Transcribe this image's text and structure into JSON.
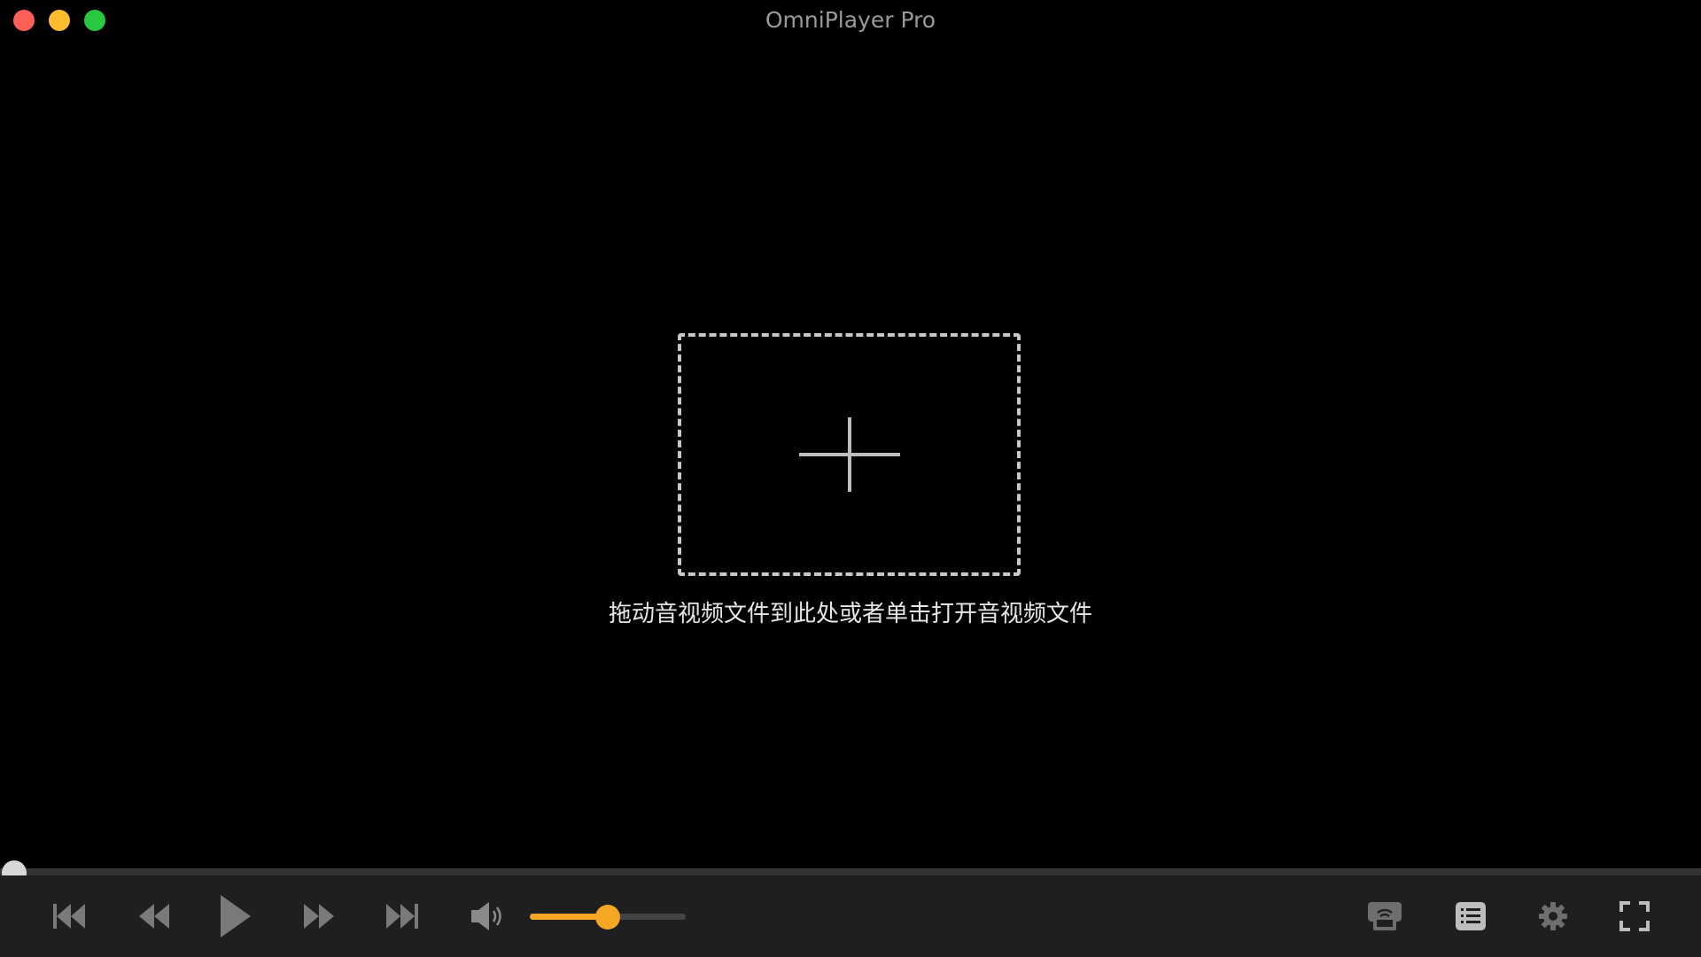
{
  "window": {
    "title": "OmniPlayer Pro"
  },
  "dropzone": {
    "hint": "拖动音视频文件到此处或者单击打开音视频文件",
    "icon": "plus-icon"
  },
  "playback": {
    "progress": 0.0
  },
  "volume": {
    "level": 0.5
  },
  "controls": {
    "left": [
      "skip-to-start-icon",
      "rewind-icon",
      "play-icon",
      "fast-forward-icon",
      "skip-to-end-icon",
      "volume-icon"
    ],
    "right": [
      "airplay-icon",
      "playlist-icon",
      "gear-icon",
      "fullscreen-icon"
    ]
  },
  "colors": {
    "accent": "#f5a623",
    "close": "#fe5f57",
    "minimize": "#febc2e",
    "zoom": "#28c840",
    "control_icon": "#7a7a7a",
    "control_bar": "#1f1f1f"
  }
}
